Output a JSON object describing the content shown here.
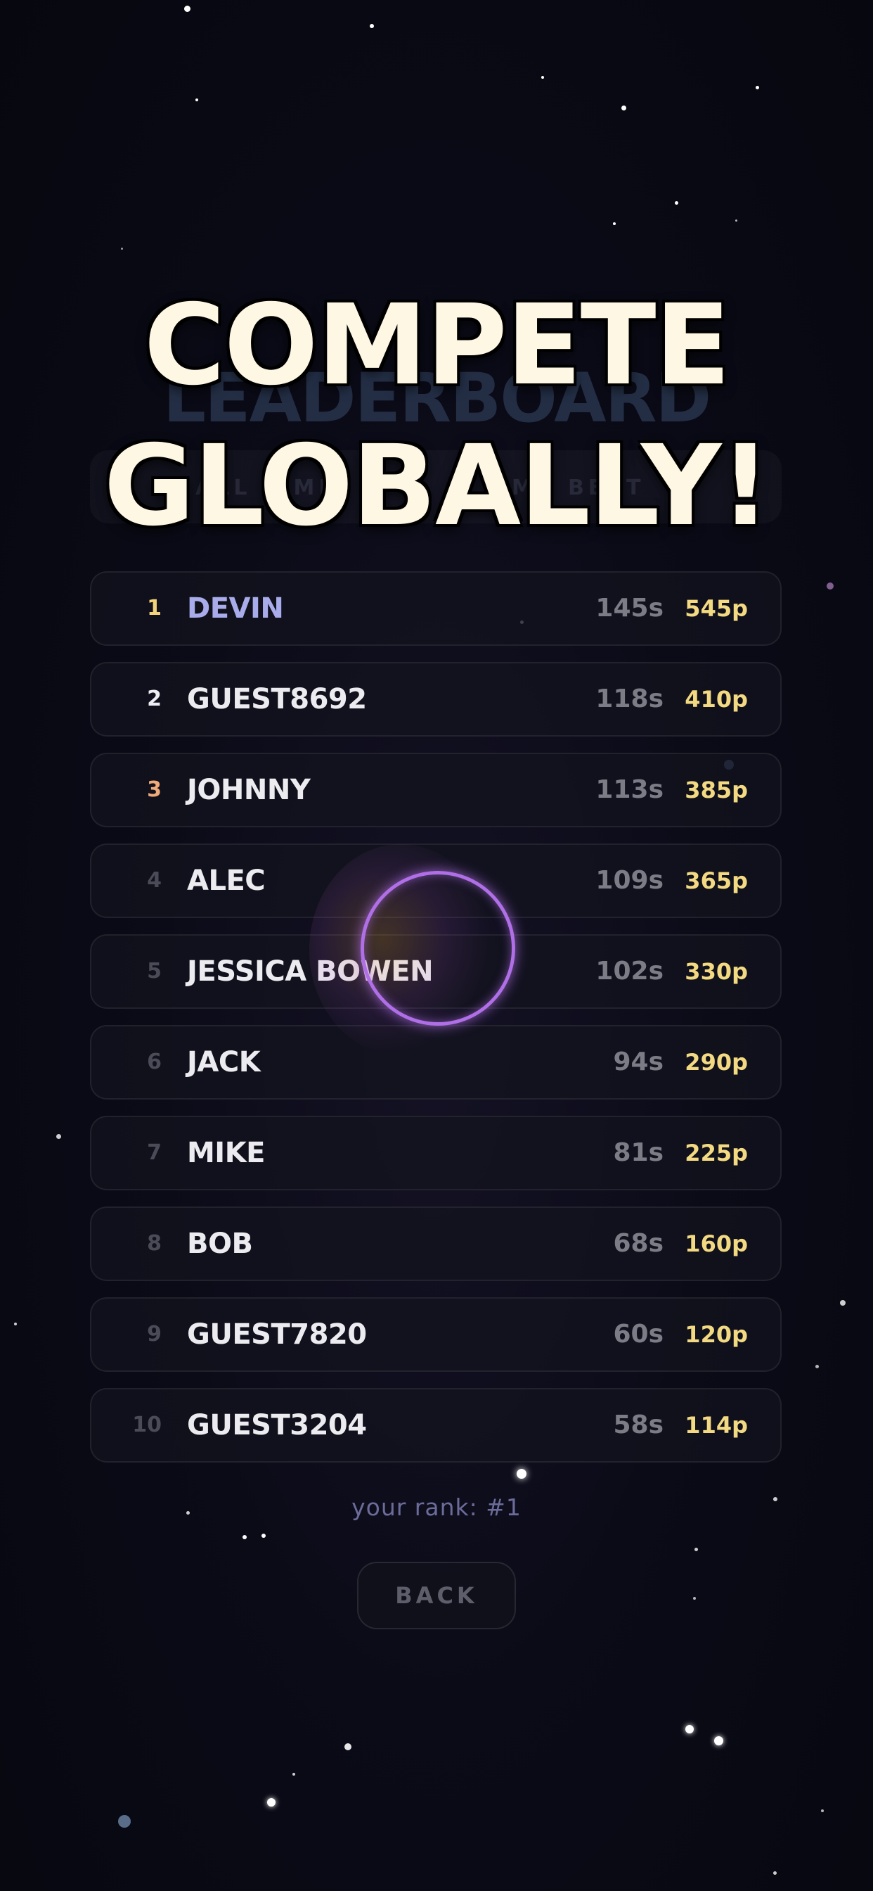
{
  "background_title": "LEADERBOARD",
  "background_tabs": [
    "ALL TIME",
    "MY BEST"
  ],
  "headline": [
    "COMPETE",
    "GLOBALLY!"
  ],
  "leaderboard": [
    {
      "rank": "1",
      "name": "DEVIN",
      "time": "145s",
      "score": "545p"
    },
    {
      "rank": "2",
      "name": "GUEST8692",
      "time": "118s",
      "score": "410p"
    },
    {
      "rank": "3",
      "name": "JOHNNY",
      "time": "113s",
      "score": "385p"
    },
    {
      "rank": "4",
      "name": "ALEC",
      "time": "109s",
      "score": "365p"
    },
    {
      "rank": "5",
      "name": "JESSICA BOWEN",
      "time": "102s",
      "score": "330p"
    },
    {
      "rank": "6",
      "name": "JACK",
      "time": "94s",
      "score": "290p"
    },
    {
      "rank": "7",
      "name": "MIKE",
      "time": "81s",
      "score": "225p"
    },
    {
      "rank": "8",
      "name": "BOB",
      "time": "68s",
      "score": "160p"
    },
    {
      "rank": "9",
      "name": "GUEST7820",
      "time": "60s",
      "score": "120p"
    },
    {
      "rank": "10",
      "name": "GUEST3204",
      "time": "58s",
      "score": "114p"
    }
  ],
  "your_rank": "your rank: #1",
  "back_label": "BACK",
  "colors": {
    "background": "#0b0b18",
    "headline": "#fdf7e4",
    "score": "#f3da82",
    "highlight_name": "#a9acea",
    "rank_gold": "#f2d27a",
    "rank_bronze": "#f0ab7a",
    "ring": "#b06fe6"
  }
}
